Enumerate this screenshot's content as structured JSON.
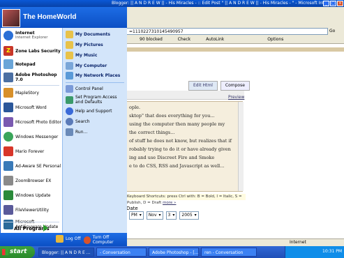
{
  "window": {
    "title": "Blogger: || A N D R E W || - His Miracles - :: Edit Post \" || A N D R E W || - His Miracles - \" - Microsoft Internet Explorer",
    "address": "=1110227310145490957",
    "go_label": "Go",
    "links": [
      "90 blocked",
      "Check",
      "AutoLink",
      "Options"
    ]
  },
  "editor": {
    "tabs": [
      "Edit Html",
      "Compose"
    ],
    "preview_label": "Preview",
    "lines": [
      "ople.",
      "sktop\" that does everything for you...",
      "using the computer then many people my",
      "the correct things...",
      "of stuff he does not know, but realizes that if",
      "robably trying to do it or have already given",
      "ing and use Discreet Fire and Smoke",
      "e to do CSS, RSS and Javascript as well..."
    ],
    "shortcuts": "Keyboard Shortcuts: press Ctrl with: B = Bold, I = Italic, S = Publish, D = Draft",
    "more_label": "more »"
  },
  "post_date": {
    "label": "Date",
    "ampm": "PM",
    "month": "Nov",
    "day": "3",
    "year": "2005"
  },
  "status": {
    "zone": "Internet"
  },
  "start_menu": {
    "user": "The HomeWorld",
    "pinned": [
      {
        "title": "Internet",
        "subtitle": "Internet Explorer",
        "icon": "internet-explorer-icon",
        "color": "#2a6fd6"
      },
      {
        "title": "Zone Labs Security",
        "subtitle": "",
        "icon": "zonealarm-icon",
        "color": "#c8362a"
      },
      {
        "title": "Notepad",
        "subtitle": "",
        "icon": "notepad-icon",
        "color": "#6aa5d8"
      },
      {
        "title": "Adobe Photoshop 7.0",
        "subtitle": "",
        "icon": "photoshop-icon",
        "color": "#4b6fa3"
      }
    ],
    "recent": [
      {
        "label": "MapleStory",
        "icon": "maplestory-icon",
        "color": "#d8902a"
      },
      {
        "label": "Microsoft Word",
        "icon": "word-icon",
        "color": "#2b579a"
      },
      {
        "label": "Microsoft Photo Editor",
        "icon": "photo-editor-icon",
        "color": "#7a5ab0"
      },
      {
        "label": "Windows Messenger",
        "icon": "messenger-icon",
        "color": "#3aa55a"
      },
      {
        "label": "Mario Forever",
        "icon": "mario-icon",
        "color": "#d8362a"
      },
      {
        "label": "Ad-Aware SE Personal",
        "icon": "adaware-icon",
        "color": "#3a7ab8"
      },
      {
        "label": "ZoomBrowser EX",
        "icon": "zoombrowser-icon",
        "color": "#8a8a8a"
      },
      {
        "label": "Windows Update",
        "icon": "windows-update-icon",
        "color": "#2a8a3a"
      },
      {
        "label": "FileViewerUtility",
        "icon": "fileviewer-icon",
        "color": "#5a5a9a"
      },
      {
        "label": "Microsoft AntiSpyware Update",
        "icon": "antispyware-icon",
        "color": "#2a6a9a"
      }
    ],
    "all_programs": "All Programs",
    "places": [
      {
        "label": "My Documents",
        "icon": "my-documents-icon",
        "color": "#e8c24a"
      },
      {
        "label": "My Pictures",
        "icon": "my-pictures-icon",
        "color": "#e8c24a"
      },
      {
        "label": "My Music",
        "icon": "my-music-icon",
        "color": "#e8c24a"
      },
      {
        "label": "My Computer",
        "icon": "my-computer-icon",
        "color": "#7aa6d8"
      },
      {
        "label": "My Network Places",
        "icon": "network-places-icon",
        "color": "#5a9ad8"
      }
    ],
    "system": [
      {
        "label": "Control Panel",
        "icon": "control-panel-icon",
        "color": "#7a9ad8"
      },
      {
        "label": "Set Program Access and Defaults",
        "icon": "program-access-icon",
        "color": "#3a9a6a"
      },
      {
        "label": "Help and Support",
        "icon": "help-icon",
        "color": "#3a6ad8"
      },
      {
        "label": "Search",
        "icon": "search-icon",
        "color": "#5a7ab8"
      },
      {
        "label": "Run...",
        "icon": "run-icon",
        "color": "#6a8ab8"
      }
    ],
    "log_off": "Log Off",
    "turn_off": "Turn Off Computer"
  },
  "taskbar": {
    "start": "start",
    "tasks": [
      "Blogger: || A N D R E ...",
      "- Conversation",
      "Adobe Photoshop - [...]",
      "ren - Conversation"
    ],
    "clock": "10:31 PM"
  }
}
